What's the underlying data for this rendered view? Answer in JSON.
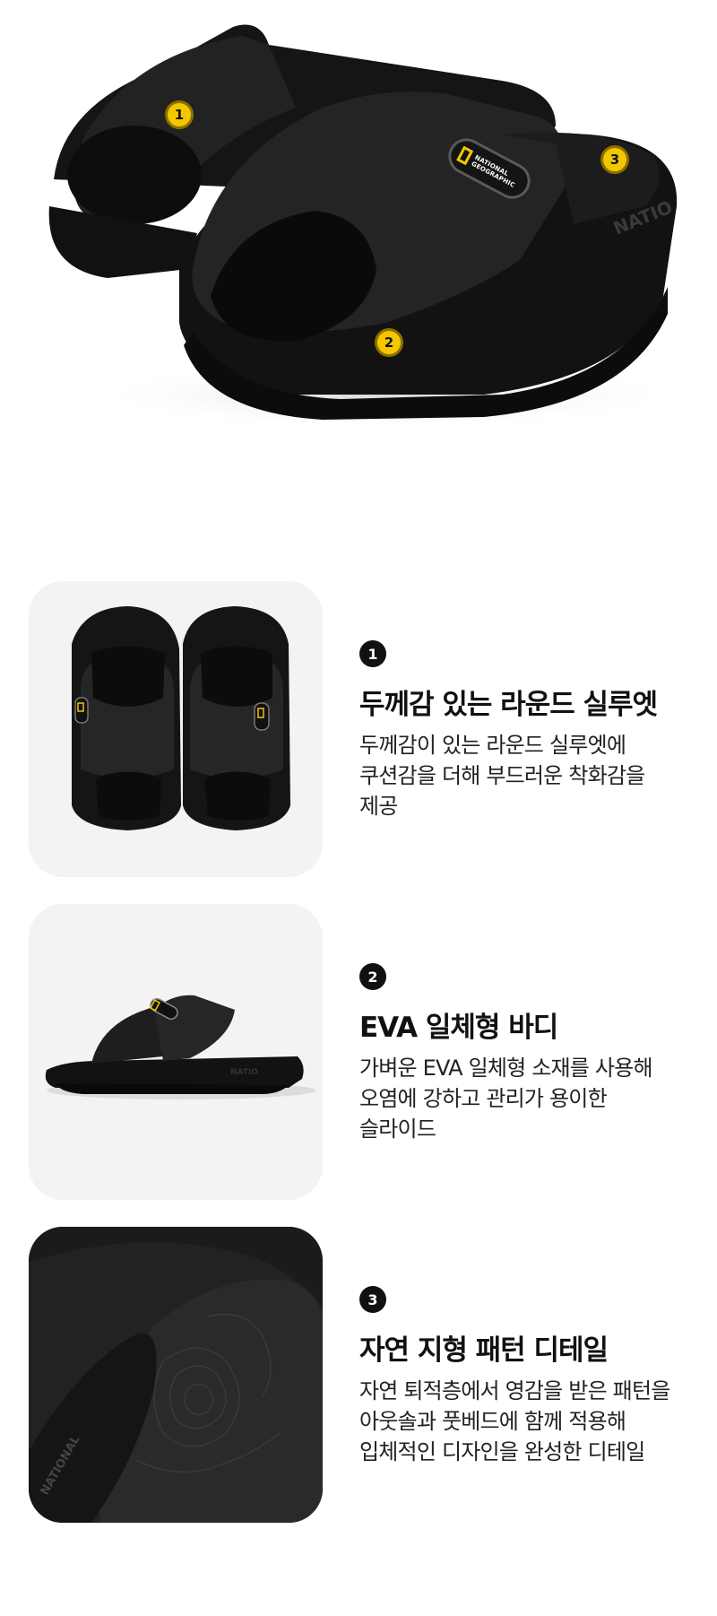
{
  "hero": {
    "markers": [
      "1",
      "2",
      "3"
    ],
    "badge_text_line1": "NATIONAL",
    "badge_text_line2": "GEOGRAPHIC",
    "sole_text": "NATIO"
  },
  "features": [
    {
      "number": "1",
      "title": "두께감 있는 라운드 실루엣",
      "desc_lines": [
        "두께감이 있는 라운드 실루엣에",
        "쿠션감을 더해 부드러운 착화감을",
        "제공"
      ]
    },
    {
      "number": "2",
      "title": "EVA 일체형 바디",
      "desc_lines": [
        "가벼운 EVA 일체형 소재를 사용해",
        "오염에 강하고 관리가 용이한",
        "슬라이드"
      ]
    },
    {
      "number": "3",
      "title": "자연 지형 패턴 디테일",
      "desc_lines": [
        "자연 퇴적층에서 영감을 받은 패턴을",
        "아웃솔과 풋베드에 함께 적용해",
        "입체적인 디자인을 완성한 디테일"
      ]
    }
  ],
  "colors": {
    "accent_marker": "#f2c700",
    "product": "#1b1b1b",
    "card_bg": "#f3f3f3"
  },
  "icons": [
    "number-marker-icon",
    "brand-badge-icon"
  ]
}
